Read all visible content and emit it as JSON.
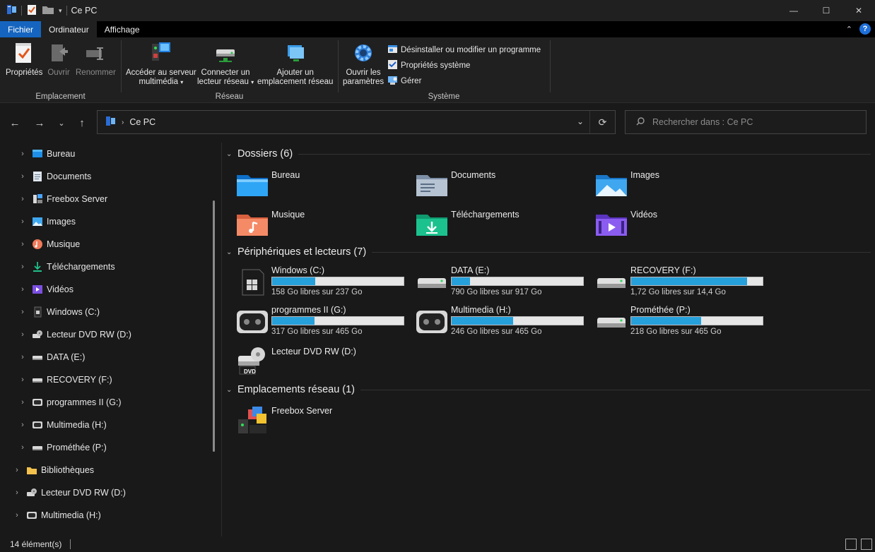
{
  "window": {
    "title": "Ce PC",
    "controls": {
      "minimize": "—",
      "maximize": "☐",
      "close": "✕"
    }
  },
  "ribbon_tabs": [
    "Fichier",
    "Ordinateur",
    "Affichage"
  ],
  "ribbon": {
    "location": {
      "label": "Emplacement",
      "properties": "Propriétés",
      "open": "Ouvrir",
      "rename": "Renommer"
    },
    "network": {
      "label": "Réseau",
      "media_server_line1": "Accéder au serveur",
      "media_server_line2": "multimédia",
      "map_drive_line1": "Connecter un",
      "map_drive_line2": "lecteur réseau",
      "add_location_line1": "Ajouter un",
      "add_location_line2": "emplacement réseau"
    },
    "system": {
      "label": "Système",
      "settings_line1": "Ouvrir les",
      "settings_line2": "paramètres",
      "uninstall": "Désinstaller ou modifier un programme",
      "system_properties": "Propriétés système",
      "manage": "Gérer"
    }
  },
  "address": {
    "path": "Ce PC",
    "search_placeholder": "Rechercher dans : Ce PC"
  },
  "sidebar": {
    "items": [
      {
        "label": "Bureau",
        "icon": "desktop-icon"
      },
      {
        "label": "Documents",
        "icon": "documents-icon"
      },
      {
        "label": "Freebox Server",
        "icon": "media-server-icon"
      },
      {
        "label": "Images",
        "icon": "pictures-icon"
      },
      {
        "label": "Musique",
        "icon": "music-icon"
      },
      {
        "label": "Téléchargements",
        "icon": "downloads-icon"
      },
      {
        "label": "Vidéos",
        "icon": "videos-icon"
      },
      {
        "label": "Windows (C:)",
        "icon": "windows-drive-icon"
      },
      {
        "label": "Lecteur DVD RW (D:)",
        "icon": "dvd-drive-icon"
      },
      {
        "label": "DATA (E:)",
        "icon": "drive-icon"
      },
      {
        "label": "RECOVERY (F:)",
        "icon": "drive-icon"
      },
      {
        "label": "programmes II (G:)",
        "icon": "game-drive-icon"
      },
      {
        "label": "Multimedia (H:)",
        "icon": "game-drive-icon"
      },
      {
        "label": "Prométhée (P:)",
        "icon": "drive-icon"
      }
    ],
    "roots": [
      {
        "label": "Bibliothèques",
        "icon": "libraries-icon"
      },
      {
        "label": "Lecteur DVD RW (D:)",
        "icon": "dvd-drive-icon"
      },
      {
        "label": "Multimedia (H:)",
        "icon": "game-drive-icon"
      }
    ]
  },
  "content": {
    "folders_header": "Dossiers (6)",
    "folders": [
      {
        "label": "Bureau",
        "icon": "desktop-folder-icon"
      },
      {
        "label": "Documents",
        "icon": "documents-folder-icon"
      },
      {
        "label": "Images",
        "icon": "pictures-folder-icon"
      },
      {
        "label": "Musique",
        "icon": "music-folder-icon"
      },
      {
        "label": "Téléchargements",
        "icon": "downloads-folder-icon"
      },
      {
        "label": "Vidéos",
        "icon": "videos-folder-icon"
      }
    ],
    "drives_header": "Périphériques et lecteurs (7)",
    "drives": [
      {
        "label": "Windows (C:)",
        "free": "158 Go libres sur 237 Go",
        "used_fraction": 0.33,
        "icon": "windows-drive-icon"
      },
      {
        "label": "DATA (E:)",
        "free": "790 Go libres sur 917 Go",
        "used_fraction": 0.14,
        "icon": "drive-icon"
      },
      {
        "label": "RECOVERY (F:)",
        "free": "1,72 Go libres sur 14,4 Go",
        "used_fraction": 0.88,
        "icon": "drive-icon"
      },
      {
        "label": "programmes II (G:)",
        "free": "317 Go libres sur 465 Go",
        "used_fraction": 0.32,
        "icon": "game-drive-icon"
      },
      {
        "label": "Multimedia (H:)",
        "free": "246 Go libres sur 465 Go",
        "used_fraction": 0.47,
        "icon": "game-drive-icon"
      },
      {
        "label": "Prométhée (P:)",
        "free": "218 Go libres sur 465 Go",
        "used_fraction": 0.53,
        "icon": "drive-icon"
      }
    ],
    "dvd_label": "Lecteur DVD RW (D:)",
    "dvd_badge": "DVD",
    "network_header": "Emplacements réseau (1)",
    "network": [
      {
        "label": "Freebox Server",
        "icon": "media-server-icon"
      }
    ]
  },
  "status": {
    "count": "14 élément(s)"
  },
  "colors": {
    "accent": "#1565c0",
    "bar_fill": "#26a0da",
    "background": "#191919"
  }
}
